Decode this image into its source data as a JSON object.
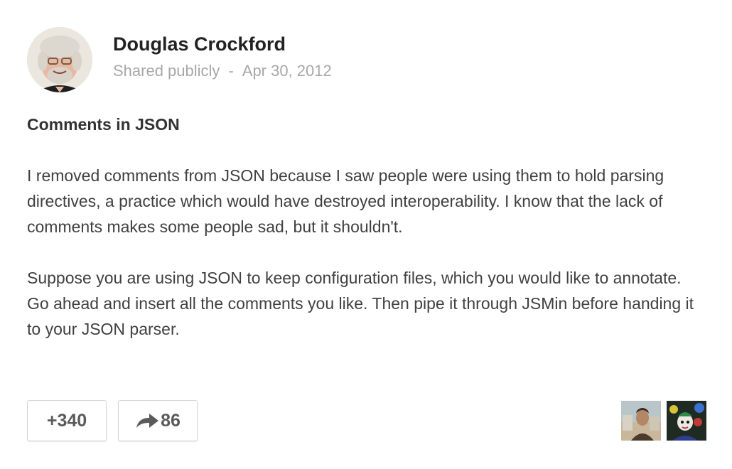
{
  "post": {
    "author": "Douglas Crockford",
    "visibility": "Shared publicly",
    "separator": "-",
    "date": "Apr 30, 2012",
    "title": "Comments in JSON",
    "paragraphs": [
      "I removed comments from JSON because I saw people were using them to hold parsing directives, a practice which would have destroyed interoperability. I know that the lack of comments makes some people sad, but it shouldn't.",
      "Suppose you are using JSON to keep configuration files, which you would like to annotate. Go ahead and insert all the comments you like. Then pipe it through JSMin before handing it to your JSON parser."
    ]
  },
  "actions": {
    "plus_one": {
      "label": "+340",
      "icon": "plus-one"
    },
    "share": {
      "count": "86",
      "icon": "share-arrow-icon"
    }
  },
  "sharers": [
    {
      "icon": "user-avatar"
    },
    {
      "icon": "user-avatar"
    }
  ],
  "colors": {
    "author": "#222222",
    "meta": "#a7a7a7",
    "body_text": "#404040",
    "button_border": "#d4d4d4",
    "button_text": "#5a5a5a"
  }
}
